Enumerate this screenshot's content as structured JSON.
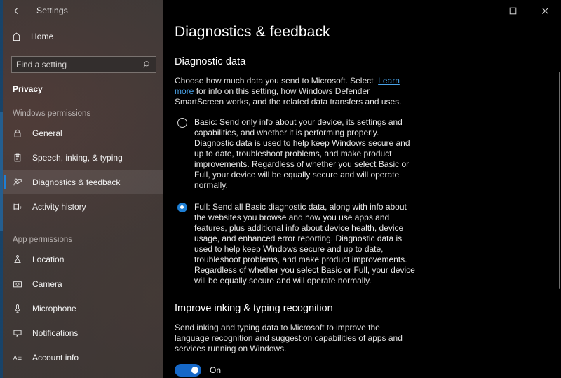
{
  "window": {
    "app_title": "Settings",
    "back_icon": "back-arrow-icon",
    "controls": {
      "minimize": "minimize-icon",
      "maximize": "maximize-icon",
      "close": "close-icon"
    }
  },
  "sidebar": {
    "home": {
      "label": "Home",
      "icon": "home-icon"
    },
    "search": {
      "placeholder": "Find a setting",
      "value": "",
      "icon": "search-icon"
    },
    "section": "Privacy",
    "groups": [
      {
        "header": "Windows permissions",
        "items": [
          {
            "label": "General",
            "icon": "lock-icon",
            "selected": false
          },
          {
            "label": "Speech, inking, & typing",
            "icon": "clipboard-icon",
            "selected": false
          },
          {
            "label": "Diagnostics & feedback",
            "icon": "feedback-person-icon",
            "selected": true
          },
          {
            "label": "Activity history",
            "icon": "activity-history-icon",
            "selected": false
          }
        ]
      },
      {
        "header": "App permissions",
        "items": [
          {
            "label": "Location",
            "icon": "location-pin-icon",
            "selected": false
          },
          {
            "label": "Camera",
            "icon": "camera-icon",
            "selected": false
          },
          {
            "label": "Microphone",
            "icon": "microphone-icon",
            "selected": false
          },
          {
            "label": "Notifications",
            "icon": "notification-icon",
            "selected": false
          },
          {
            "label": "Account info",
            "icon": "account-info-icon",
            "selected": false
          }
        ]
      }
    ]
  },
  "main": {
    "page_title": "Diagnostics & feedback",
    "diagnostic_data": {
      "title": "Diagnostic data",
      "intro_before_link": "Choose how much data you send to Microsoft. Select",
      "link_text": "Learn more",
      "intro_after_link": "for info on this setting, how Windows Defender SmartScreen works, and the related data transfers and uses.",
      "options": [
        {
          "id": "basic",
          "selected": false,
          "text": "Basic: Send only info about your device, its settings and capabilities, and whether it is performing properly. Diagnostic data is used to help keep Windows secure and up to date, troubleshoot problems, and make product improvements. Regardless of whether you select Basic or Full, your device will be equally secure and will operate normally."
        },
        {
          "id": "full",
          "selected": true,
          "text": "Full: Send all Basic diagnostic data, along with info about the websites you browse and how you use apps and features, plus additional info about device health, device usage, and enhanced error reporting. Diagnostic data is used to help keep Windows secure and up to date, troubleshoot problems, and make product improvements. Regardless of whether you select Basic or Full, your device will be equally secure and will operate normally."
        }
      ]
    },
    "inking": {
      "title": "Improve inking & typing recognition",
      "description": "Send inking and typing data to Microsoft to improve the language recognition and suggestion capabilities of apps and services running on Windows.",
      "toggle_state": "On"
    }
  },
  "colors": {
    "accent": "#1e7fd4",
    "toggle_on": "#1668c8",
    "link": "#4aa3e8",
    "content_bg": "#000000",
    "sidebar_bg": "#3f3836"
  }
}
